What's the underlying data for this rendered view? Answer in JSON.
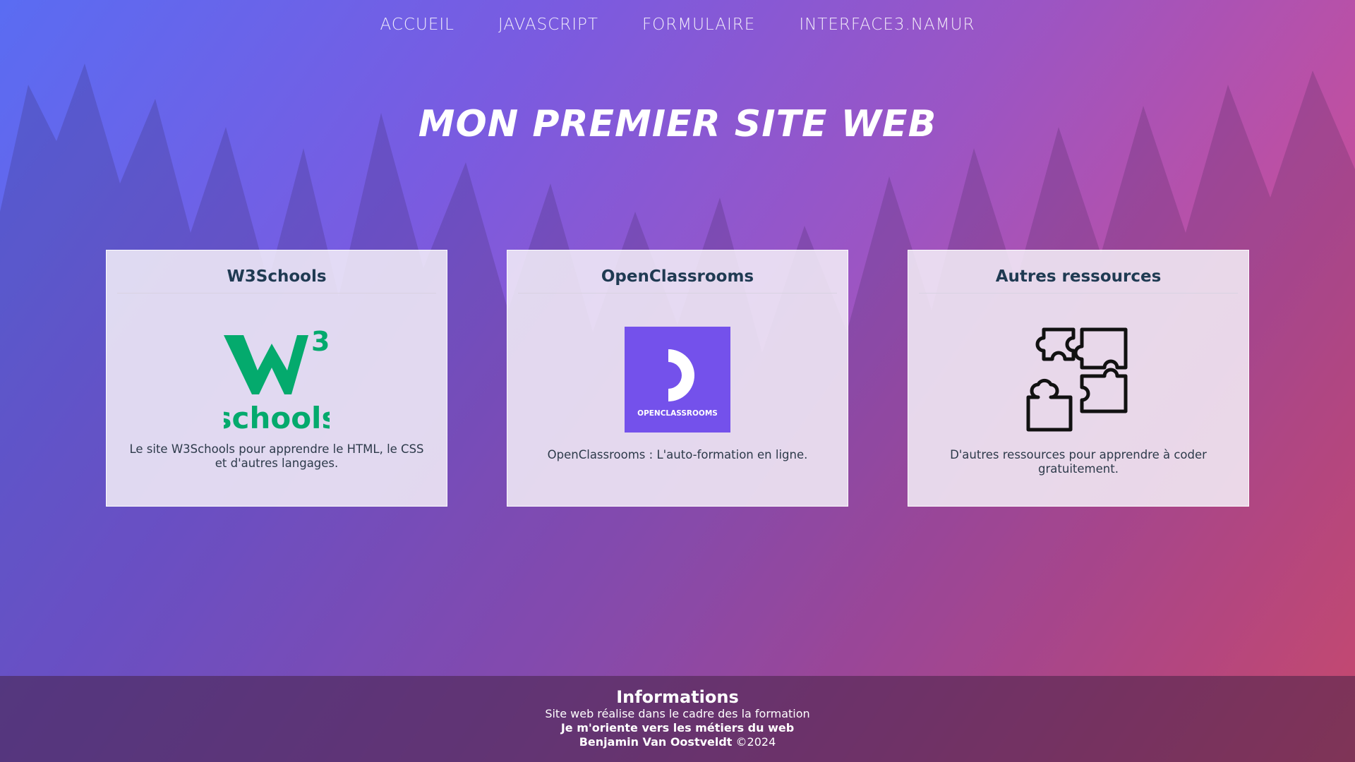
{
  "nav": {
    "items": [
      "ACCUEIL",
      "JAVASCRIPT",
      "FORMULAIRE",
      "INTERFACE3.NAMUR"
    ]
  },
  "page": {
    "title": "MON PREMIER SITE WEB"
  },
  "cards": [
    {
      "title": "W3Schools",
      "logo_text_top": "3",
      "logo_text_bottom": "schools",
      "description": "Le site W3Schools pour apprendre le HTML, le CSS et d'autres langages.",
      "icon": "w3schools-logo",
      "color": "#04AA6D"
    },
    {
      "title": "OpenClassrooms",
      "logo_text": "OPENCLASSROOMS",
      "description": "OpenClassrooms : L'auto-formation en ligne.",
      "icon": "openclassrooms-logo",
      "color": "#7451EB"
    },
    {
      "title": "Autres ressources",
      "description": "D'autres ressources pour apprendre à coder gratuitement.",
      "icon": "puzzle-icon"
    }
  ],
  "footer": {
    "title": "Informations",
    "line1": "Site web réalise dans le cadre des la formation",
    "line2": "Je m'oriente vers les métiers du web",
    "author": "Benjamin Van Oostveldt",
    "copyright": "©2024"
  }
}
